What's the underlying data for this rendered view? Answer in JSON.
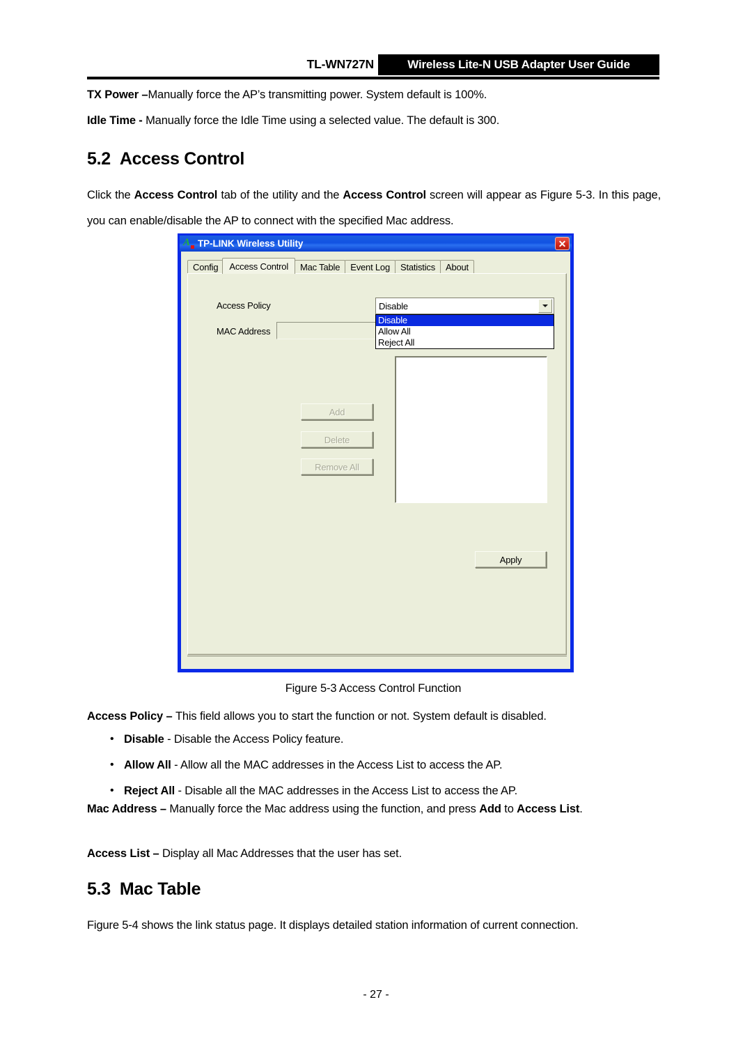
{
  "header": {
    "model": "TL-WN727N",
    "banner": "Wireless Lite-N USB Adapter User Guide"
  },
  "intro": {
    "tx_power_label": "TX Power –",
    "tx_power_text": "Manually force the AP’s transmitting power. System default is 100%.",
    "idle_time_label": "Idle Time -",
    "idle_time_text": " Manually force the Idle Time using a selected value. The default is 300."
  },
  "section_52": {
    "number": "5.2",
    "title": "Access Control",
    "para_a": "Click the ",
    "para_b": "Access Control",
    "para_c": " tab of the utility and the ",
    "para_d": "Access Control",
    "para_e": " screen will appear as Figure 5-3. In this page, you can enable/disable the AP to connect with the specified Mac address."
  },
  "dialog": {
    "title": "TP-LINK Wireless Utility",
    "icon": "tplink-a-icon",
    "close_label": "✕",
    "tabs": [
      {
        "label": "Config",
        "active": false
      },
      {
        "label": "Access Control",
        "active": true
      },
      {
        "label": "Mac Table",
        "active": false
      },
      {
        "label": "Event Log",
        "active": false
      },
      {
        "label": "Statistics",
        "active": false
      },
      {
        "label": "About",
        "active": false
      }
    ],
    "access_policy_label": "Access Policy",
    "mac_address_label": "MAC Address",
    "mac_address_value": "",
    "policy_selected": "Disable",
    "policy_options": [
      "Disable",
      "Allow All",
      "Reject All"
    ],
    "buttons": {
      "add": "Add",
      "delete": "Delete",
      "remove_all": "Remove All",
      "apply": "Apply"
    },
    "colors": {
      "dialog_bg": "#ebeedb",
      "window_border": "#0a2ae8",
      "titlebar": "#1152e2",
      "selection": "#0a2ae0",
      "close_button": "#d42a1c"
    }
  },
  "figure_caption": "Figure 5-3 Access Control Function",
  "descriptions": {
    "access_policy_label": "Access Policy – ",
    "access_policy_text": "This field allows you to start the function or not. System default is disabled.",
    "bullets": [
      {
        "term": "Disable",
        "text": " - Disable the Access Policy feature."
      },
      {
        "term": "Allow All",
        "text": " - Allow all the MAC addresses in the Access List to access the AP."
      },
      {
        "term": "Reject All",
        "text": " - Disable all the MAC addresses in the Access List to access the AP."
      }
    ],
    "mac_address_label": "Mac Address – ",
    "mac_address_text_a": "Manually force the Mac address using the function, and press ",
    "mac_address_bold_add": "Add",
    "mac_address_text_b": " to ",
    "mac_address_bold_access": "Access List",
    "mac_address_text_c": ".",
    "access_list_label": "Access List – ",
    "access_list_text": "Display all Mac Addresses that the user has set."
  },
  "section_53": {
    "number": "5.3",
    "title": "Mac Table",
    "para": "Figure 5-4 shows the link status page. It displays detailed station information of current connection."
  },
  "footer": {
    "page_number": "- 27 -"
  }
}
